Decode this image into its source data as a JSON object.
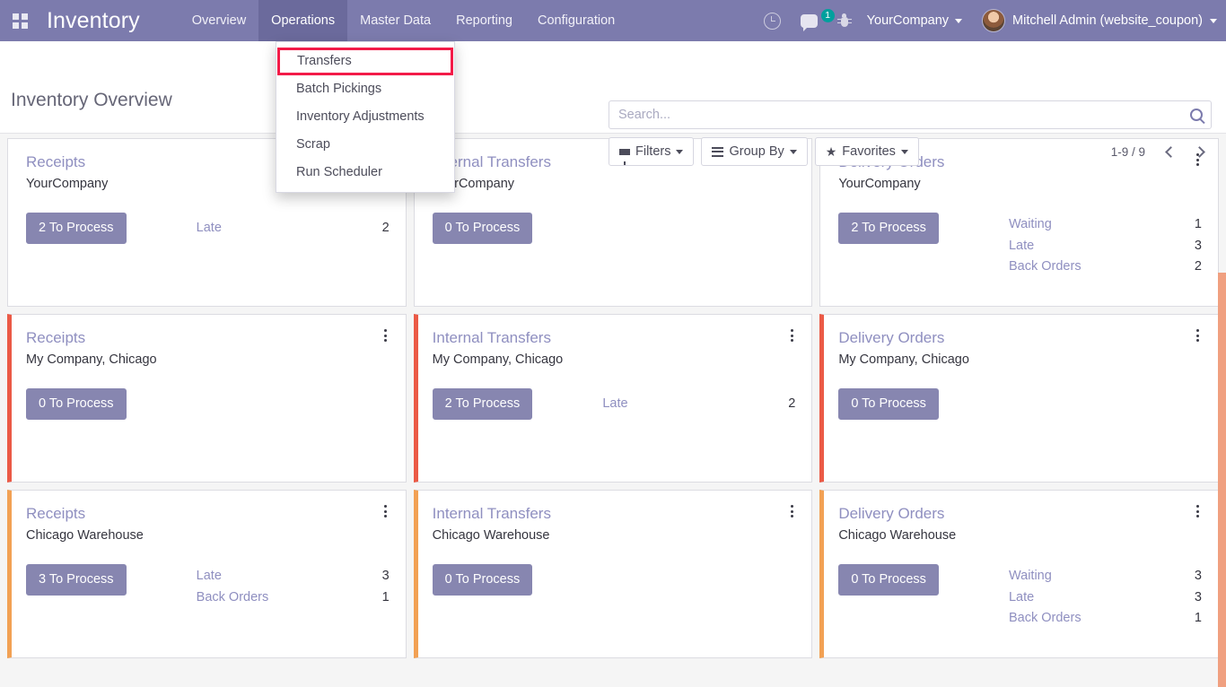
{
  "navbar": {
    "apps_icon": "apps-grid-icon",
    "brand": "Inventory",
    "menu": [
      {
        "label": "Overview",
        "active": false
      },
      {
        "label": "Operations",
        "active": true
      },
      {
        "label": "Master Data",
        "active": false
      },
      {
        "label": "Reporting",
        "active": false
      },
      {
        "label": "Configuration",
        "active": false
      }
    ],
    "activity_icon": "clock-icon",
    "messages_icon": "chat-icon",
    "messages_count": "1",
    "debug_icon": "bug-icon",
    "company": "YourCompany",
    "user": "Mitchell Admin (website_coupon)",
    "accent": "#7c7bad"
  },
  "dropdown": {
    "items": [
      {
        "label": "Transfers",
        "highlighted": true
      },
      {
        "label": "Batch Pickings",
        "highlighted": false
      },
      {
        "label": "Inventory Adjustments",
        "highlighted": false
      },
      {
        "label": "Scrap",
        "highlighted": false
      },
      {
        "label": "Run Scheduler",
        "highlighted": false
      }
    ],
    "highlight_color": "#f31b48"
  },
  "control_panel": {
    "title": "Inventory Overview",
    "search": {
      "value": "",
      "placeholder": "Search...",
      "icon": "search-icon"
    },
    "buttons": [
      {
        "label": "Filters",
        "icon": "filter-funnel-icon"
      },
      {
        "label": "Group By",
        "icon": "list-lines-icon"
      },
      {
        "label": "Favorites",
        "icon": "star-icon"
      }
    ],
    "pager": {
      "count": "1-9 / 9",
      "prev_icon": "chevron-left-icon",
      "next_icon": "chevron-right-icon"
    }
  },
  "kanban": {
    "cards": [
      {
        "title": "Receipts",
        "subtitle": "YourCompany",
        "button": "2 To Process",
        "border": "none",
        "menu_icon": "kebab-menu-icon",
        "stats": [
          {
            "label": "Late",
            "value": "2"
          }
        ]
      },
      {
        "title": "Internal Transfers",
        "subtitle": "YourCompany",
        "button": "0 To Process",
        "border": "none",
        "menu_icon": "kebab-menu-icon",
        "stats": []
      },
      {
        "title": "Delivery Orders",
        "subtitle": "YourCompany",
        "button": "2 To Process",
        "border": "none",
        "menu_icon": "kebab-menu-icon",
        "stats": [
          {
            "label": "Waiting",
            "value": "1"
          },
          {
            "label": "Late",
            "value": "3"
          },
          {
            "label": "Back Orders",
            "value": "2"
          }
        ]
      },
      {
        "title": "Receipts",
        "subtitle": "My Company, Chicago",
        "button": "0 To Process",
        "border": "red",
        "menu_icon": "kebab-menu-icon",
        "stats": []
      },
      {
        "title": "Internal Transfers",
        "subtitle": "My Company, Chicago",
        "button": "2 To Process",
        "border": "red",
        "menu_icon": "kebab-menu-icon",
        "stats": [
          {
            "label": "Late",
            "value": "2"
          }
        ]
      },
      {
        "title": "Delivery Orders",
        "subtitle": "My Company, Chicago",
        "button": "0 To Process",
        "border": "red",
        "menu_icon": "kebab-menu-icon",
        "stats": []
      },
      {
        "title": "Receipts",
        "subtitle": "Chicago Warehouse",
        "button": "3 To Process",
        "border": "orange",
        "menu_icon": "kebab-menu-icon",
        "stats": [
          {
            "label": "Late",
            "value": "3"
          },
          {
            "label": "Back Orders",
            "value": "1"
          }
        ]
      },
      {
        "title": "Internal Transfers",
        "subtitle": "Chicago Warehouse",
        "button": "0 To Process",
        "border": "orange",
        "menu_icon": "kebab-menu-icon",
        "stats": []
      },
      {
        "title": "Delivery Orders",
        "subtitle": "Chicago Warehouse",
        "button": "0 To Process",
        "border": "orange",
        "menu_icon": "kebab-menu-icon",
        "stats": [
          {
            "label": "Waiting",
            "value": "3"
          },
          {
            "label": "Late",
            "value": "3"
          },
          {
            "label": "Back Orders",
            "value": "1"
          }
        ]
      }
    ],
    "border_colors": {
      "red": "#eb5a46",
      "orange": "#f2a154"
    }
  }
}
